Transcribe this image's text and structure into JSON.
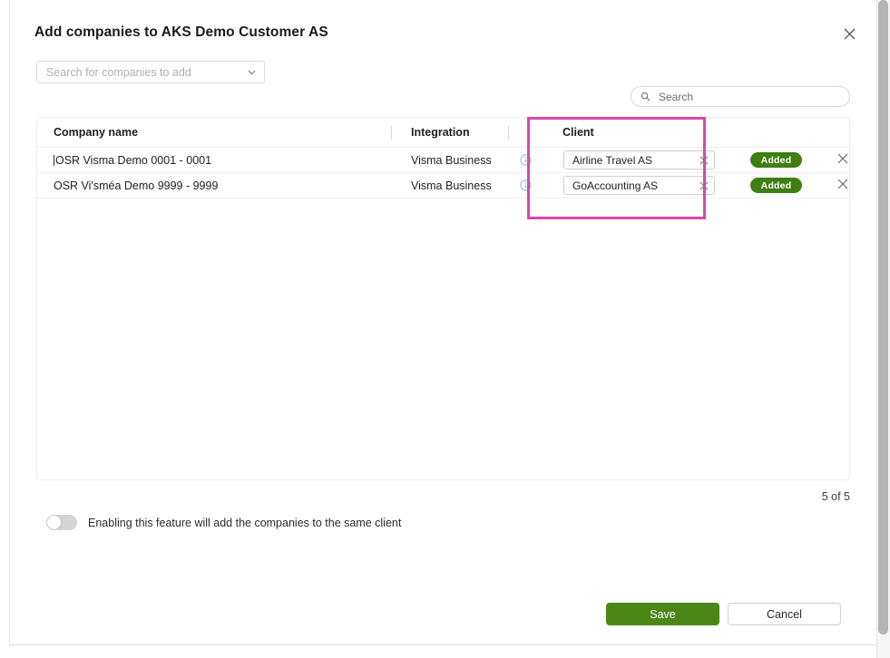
{
  "dialog": {
    "title": "Add companies to AKS Demo Customer AS",
    "close_label": "×"
  },
  "company_picker": {
    "placeholder": "Search for companies to add"
  },
  "search": {
    "placeholder": "Search"
  },
  "table": {
    "columns": {
      "company": "Company name",
      "integration": "Integration",
      "client": "Client"
    },
    "rows": [
      {
        "company": "OSR Visma Demo 0001 - 0001",
        "integration": "Visma Business",
        "client": "Airline Travel AS",
        "status": "Added"
      },
      {
        "company": "OSR Vi'sméa Demo 9999 - 9999",
        "integration": "Visma Business",
        "client": "GoAccounting AS",
        "status": "Added"
      }
    ]
  },
  "counter": "5 of 5",
  "toggle": {
    "label": "Enabling this feature will add the companies to the same client",
    "state": "off"
  },
  "footer": {
    "save": "Save",
    "cancel": "Cancel"
  },
  "colors": {
    "highlight": "#dd45ad",
    "badge_green": "#3f7f12",
    "save_green": "#4a8715",
    "info_blue": "#8fc4e8"
  }
}
